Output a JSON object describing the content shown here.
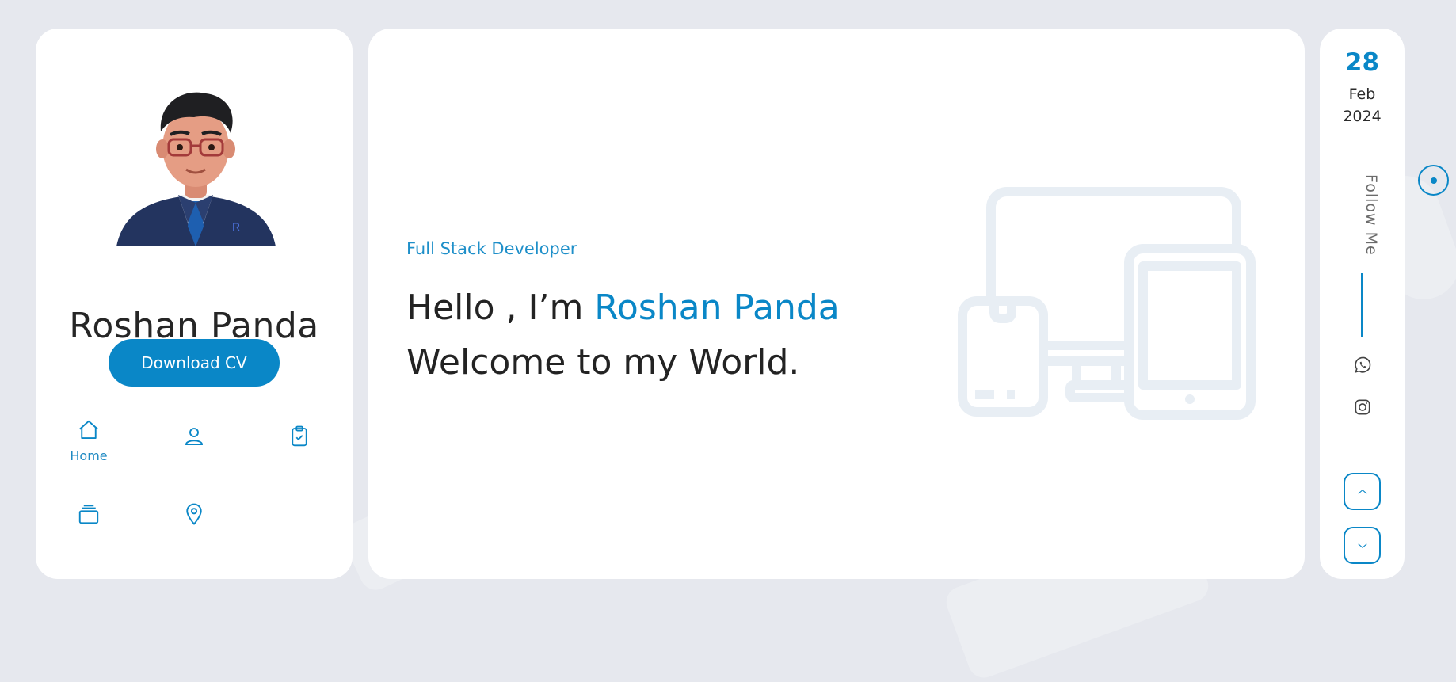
{
  "profile": {
    "name": "Roshan Panda",
    "download_label": "Download CV",
    "avatar_icon": "avatar-illustration",
    "nav": [
      {
        "id": "home",
        "label": "Home",
        "icon": "home-icon"
      },
      {
        "id": "about",
        "label": "",
        "icon": "user-icon"
      },
      {
        "id": "resume",
        "label": "",
        "icon": "clipboard-check-icon"
      },
      {
        "id": "portfolio",
        "label": "",
        "icon": "layers-icon"
      },
      {
        "id": "contact",
        "label": "",
        "icon": "map-pin-icon"
      }
    ]
  },
  "hero": {
    "role": "Full Stack Developer",
    "greeting_prefix": "Hello , I’m ",
    "greeting_name": "Roshan Panda",
    "tagline": "Welcome to my World.",
    "illustration_icon": "devices-illustration"
  },
  "sidebar": {
    "date": {
      "day": "28",
      "month": "Feb",
      "year": "2024"
    },
    "follow_label": "Follow Me",
    "socials": [
      {
        "name": "whatsapp",
        "icon": "whatsapp-icon"
      },
      {
        "name": "instagram",
        "icon": "instagram-icon"
      }
    ],
    "scroll_up_icon": "chevron-up-icon",
    "scroll_down_icon": "chevron-down-icon"
  },
  "colors": {
    "accent": "#0a87c7",
    "background": "#e6e8ee",
    "card": "#ffffff",
    "text_dark": "#232323",
    "illustration": "#e8eef4"
  }
}
